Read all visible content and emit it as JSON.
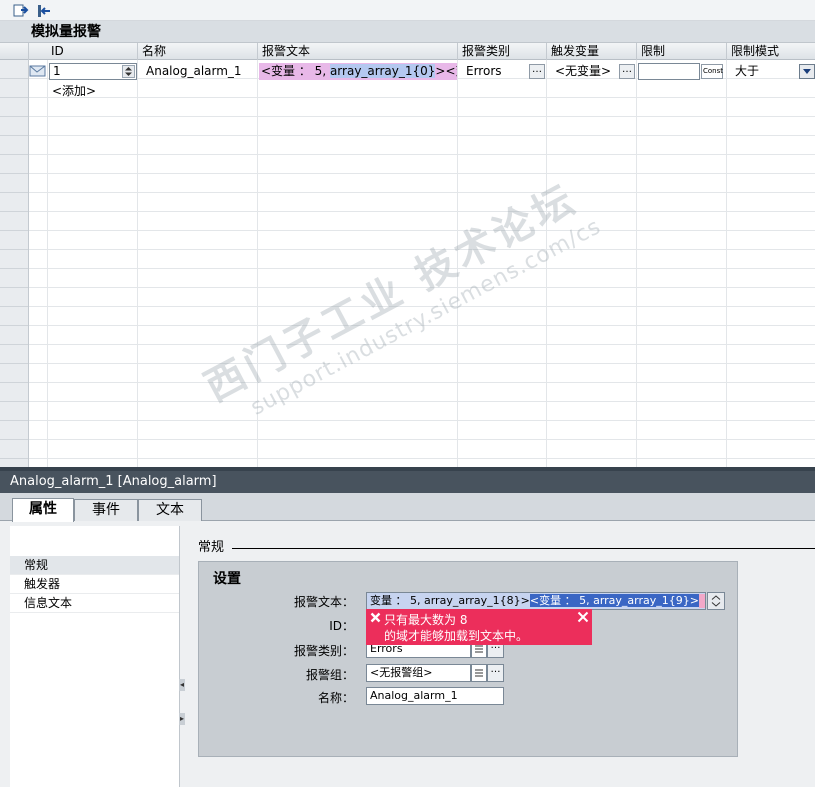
{
  "grid": {
    "title": "模拟量报警",
    "columns": [
      "ID",
      "名称",
      "报警文本",
      "报警类别",
      "触发变量",
      "限制",
      "限制模式"
    ],
    "rows": [
      {
        "id": "1",
        "name": "Analog_alarm_1",
        "alarm_text_prefix": "<变量 ： 5, ",
        "alarm_text_sel": "array_array_1{0}",
        "alarm_text_suffix": "><变量",
        "class": "Errors",
        "trigger": "<无变量>",
        "limit": "",
        "const_label": "Const",
        "limit_mode": "大于"
      }
    ],
    "add_label": "<添加>"
  },
  "properties": {
    "title": "Analog_alarm_1 [Analog_alarm]",
    "tabs": [
      "属性",
      "事件",
      "文本"
    ],
    "nav": [
      "常规",
      "触发器",
      "信息文本"
    ],
    "section_label": "常规",
    "settings_title": "设置",
    "fields": {
      "alarm_text_label": "报警文本：",
      "alarm_text_part1": "变量 ： 5,  array_array_1{8}>",
      "alarm_text_part2": "<变量 ： 5,  array_array_1{9}>",
      "id_label": "ID：",
      "class_label": "报警类别：",
      "class_value": "Errors",
      "group_label": "报警组：",
      "group_value": "<无报警组>",
      "name_label": "名称：",
      "name_value": "Analog_alarm_1"
    },
    "error": {
      "line1": "只有最大数为 8",
      "line2": "的域才能够加载到文本中。"
    }
  },
  "watermark": {
    "line1": "西门子工业 技术论坛",
    "line2": "support.industry.siemens.com/cs"
  },
  "colors": {
    "error_bg": "#ec2e5b",
    "title_bar": "#48535e",
    "selection": "#3a66c4"
  }
}
